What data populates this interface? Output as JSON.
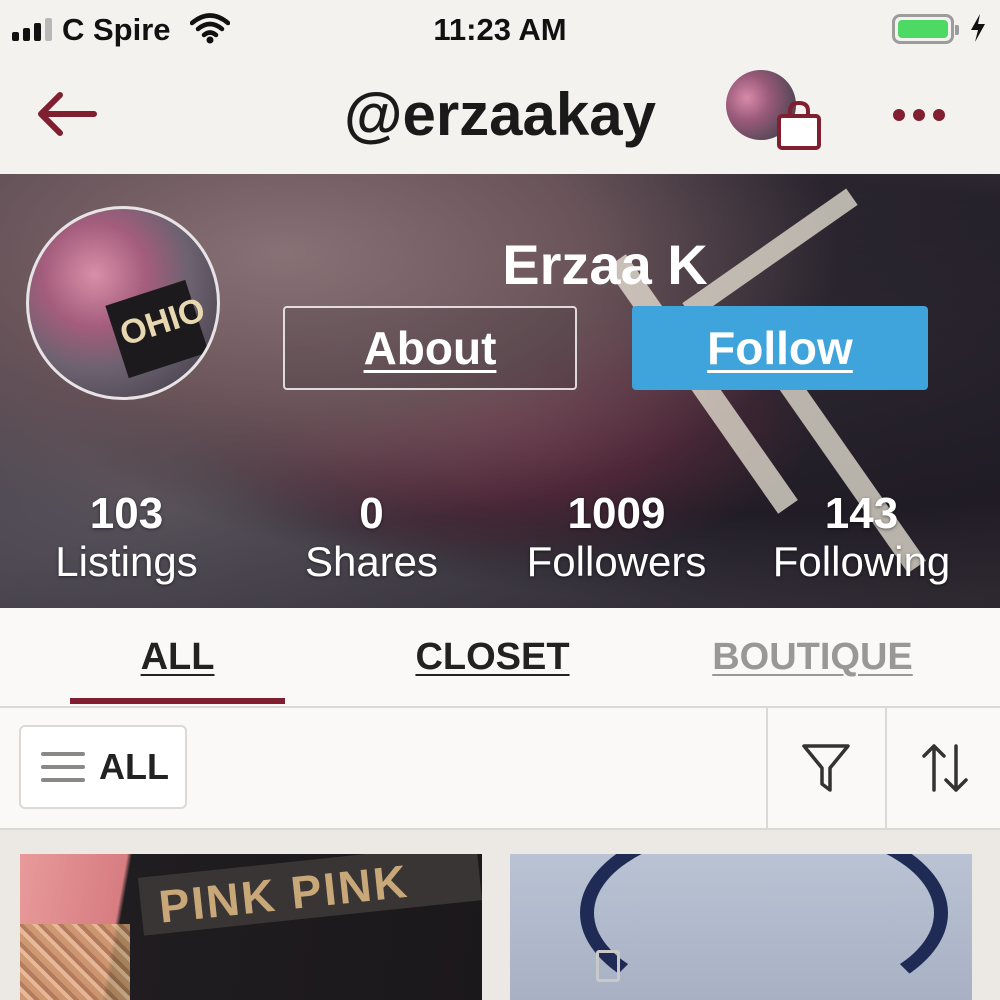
{
  "status_bar": {
    "carrier": "C Spire",
    "time": "11:23 AM",
    "signal_bars": 4,
    "signal_strength": 3,
    "battery_color": "#4cd964"
  },
  "nav": {
    "title": "@erzaakay",
    "back_icon": "back-arrow-icon",
    "bag_icon": "shopping-bag-icon",
    "more_icon": "more-dots-icon",
    "accent": "#7f1f2f"
  },
  "profile": {
    "display_name": "Erzaa K",
    "about_label": "About",
    "follow_label": "Follow",
    "follow_color": "#3fa3dc",
    "avatar_text": "OHIO",
    "stats": [
      {
        "value": "103",
        "label": "Listings"
      },
      {
        "value": "0",
        "label": "Shares"
      },
      {
        "value": "1009",
        "label": "Followers"
      },
      {
        "value": "143",
        "label": "Following"
      }
    ]
  },
  "tabs": [
    {
      "label": "ALL",
      "active": true
    },
    {
      "label": "CLOSET",
      "active": false
    },
    {
      "label": "BOUTIQUE",
      "active": false
    }
  ],
  "filter_bar": {
    "category_label": "ALL",
    "category_icon": "menu-lines-icon",
    "filter_icon": "filter-icon",
    "sort_icon": "sort-arrows-icon"
  },
  "listings": [
    {
      "image_text": "PINK PINK"
    },
    {
      "image_text": ""
    }
  ]
}
